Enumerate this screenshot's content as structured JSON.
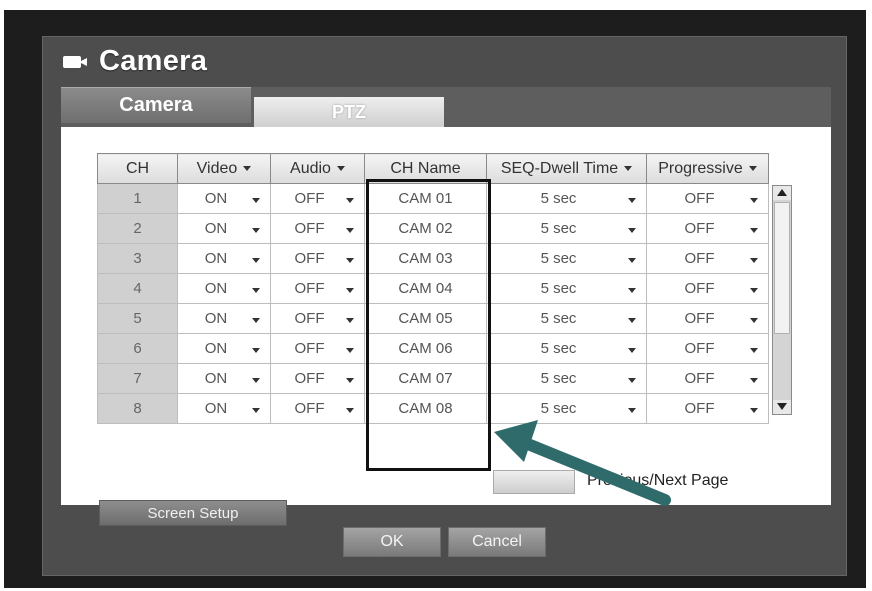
{
  "window": {
    "title": "Camera",
    "icon": "camera-icon"
  },
  "tabs": [
    {
      "label": "Camera",
      "active": true
    },
    {
      "label": "PTZ",
      "active": false
    }
  ],
  "table": {
    "headers": {
      "ch": "CH",
      "video": "Video",
      "audio": "Audio",
      "name": "CH Name",
      "seq": "SEQ-Dwell Time",
      "prog": "Progressive"
    },
    "rows": [
      {
        "ch": "1",
        "video": "ON",
        "audio": "OFF",
        "name": "CAM 01",
        "seq": "5 sec",
        "prog": "OFF"
      },
      {
        "ch": "2",
        "video": "ON",
        "audio": "OFF",
        "name": "CAM 02",
        "seq": "5 sec",
        "prog": "OFF"
      },
      {
        "ch": "3",
        "video": "ON",
        "audio": "OFF",
        "name": "CAM 03",
        "seq": "5 sec",
        "prog": "OFF"
      },
      {
        "ch": "4",
        "video": "ON",
        "audio": "OFF",
        "name": "CAM 04",
        "seq": "5 sec",
        "prog": "OFF"
      },
      {
        "ch": "5",
        "video": "ON",
        "audio": "OFF",
        "name": "CAM 05",
        "seq": "5 sec",
        "prog": "OFF"
      },
      {
        "ch": "6",
        "video": "ON",
        "audio": "OFF",
        "name": "CAM 06",
        "seq": "5 sec",
        "prog": "OFF"
      },
      {
        "ch": "7",
        "video": "ON",
        "audio": "OFF",
        "name": "CAM 07",
        "seq": "5 sec",
        "prog": "OFF"
      },
      {
        "ch": "8",
        "video": "ON",
        "audio": "OFF",
        "name": "CAM 08",
        "seq": "5 sec",
        "prog": "OFF"
      }
    ]
  },
  "pagination": {
    "label": "Previous/Next Page"
  },
  "buttons": {
    "screen_setup": "Screen Setup",
    "ok": "OK",
    "cancel": "Cancel"
  },
  "annotation": {
    "arrow_color": "#2f6b6b",
    "highlight_color": "#111111"
  }
}
